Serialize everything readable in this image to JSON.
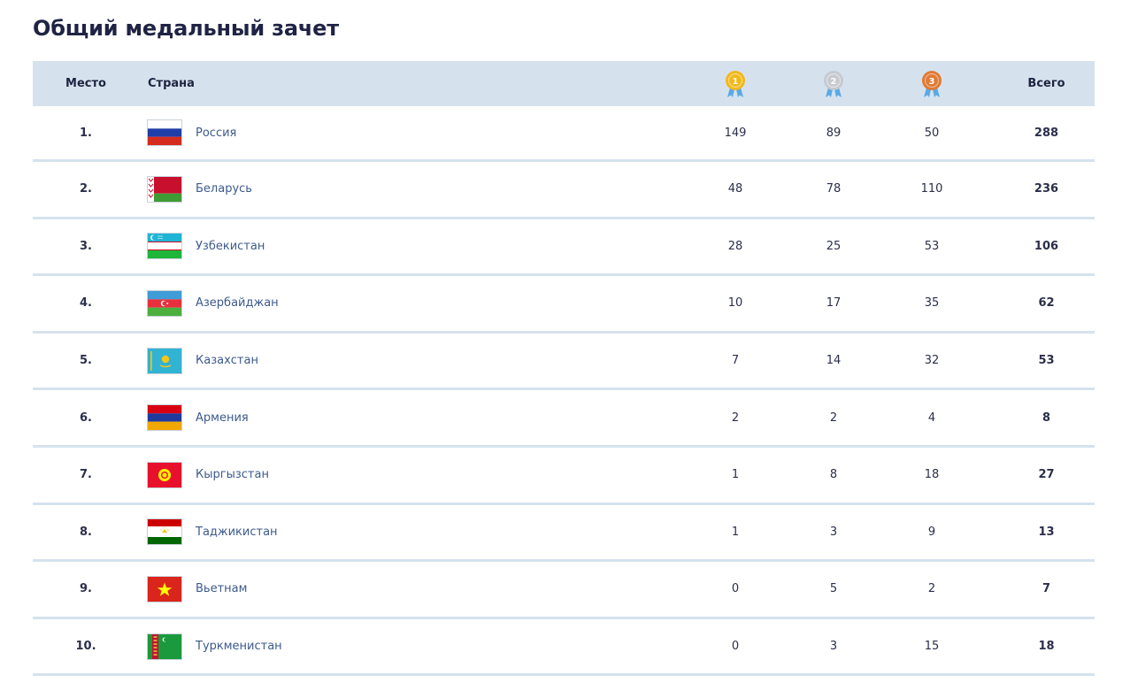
{
  "page": {
    "title": "Общий медальный зачет"
  },
  "table": {
    "headers": {
      "rank": "Место",
      "country": "Страна",
      "gold": "1",
      "silver": "2",
      "bronze": "3",
      "total": "Всего"
    },
    "medal_colors": {
      "gold": "#f2b81b",
      "silver": "#c6c9cf",
      "bronze": "#e07a34",
      "ribbon": "#5aa9e6"
    },
    "rows": [
      {
        "rank": "1.",
        "country": "Россия",
        "flag": "russia-flag-icon",
        "gold": "149",
        "silver": "89",
        "bronze": "50",
        "total": "288"
      },
      {
        "rank": "2.",
        "country": "Беларусь",
        "flag": "belarus-flag-icon",
        "gold": "48",
        "silver": "78",
        "bronze": "110",
        "total": "236"
      },
      {
        "rank": "3.",
        "country": "Узбекистан",
        "flag": "uzbekistan-flag-icon",
        "gold": "28",
        "silver": "25",
        "bronze": "53",
        "total": "106"
      },
      {
        "rank": "4.",
        "country": "Азербайджан",
        "flag": "azerbaijan-flag-icon",
        "gold": "10",
        "silver": "17",
        "bronze": "35",
        "total": "62"
      },
      {
        "rank": "5.",
        "country": "Казахстан",
        "flag": "kazakhstan-flag-icon",
        "gold": "7",
        "silver": "14",
        "bronze": "32",
        "total": "53"
      },
      {
        "rank": "6.",
        "country": "Армения",
        "flag": "armenia-flag-icon",
        "gold": "2",
        "silver": "2",
        "bronze": "4",
        "total": "8"
      },
      {
        "rank": "7.",
        "country": "Кыргызстан",
        "flag": "kyrgyzstan-flag-icon",
        "gold": "1",
        "silver": "8",
        "bronze": "18",
        "total": "27"
      },
      {
        "rank": "8.",
        "country": "Таджикистан",
        "flag": "tajikistan-flag-icon",
        "gold": "1",
        "silver": "3",
        "bronze": "9",
        "total": "13"
      },
      {
        "rank": "9.",
        "country": "Вьетнам",
        "flag": "vietnam-flag-icon",
        "gold": "0",
        "silver": "5",
        "bronze": "2",
        "total": "7"
      },
      {
        "rank": "10.",
        "country": "Туркменистан",
        "flag": "turkmenistan-flag-icon",
        "gold": "0",
        "silver": "3",
        "bronze": "15",
        "total": "18"
      }
    ]
  }
}
